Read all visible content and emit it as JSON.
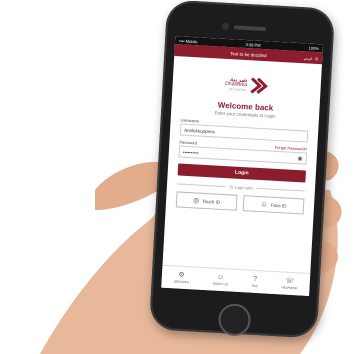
{
  "status": {
    "carrier": "•••• Mobile",
    "time": "3:38 PM",
    "battery": "100%"
  },
  "topbar": {
    "title": "Text to be decided",
    "lang": "عربي"
  },
  "logo": {
    "arabic": "ضريبة",
    "english": "Dhareeba",
    "tagline": "TAX PORTAL"
  },
  "welcome": {
    "title": "Welcome back",
    "subtitle": "Enter your credentials to Login"
  },
  "form": {
    "username_label": "Username",
    "username_value": "Annlekkuppens",
    "password_label": "Password",
    "forgot_label": "Forgot Password?",
    "password_value": "••••••••••"
  },
  "login_label": "Login",
  "or_label": "Or Login with",
  "biometrics": {
    "touch_label": "Touch ID",
    "face_label": "Face ID"
  },
  "tabs": [
    {
      "label": "SERVICES",
      "icon": "gear-icon"
    },
    {
      "label": "ABOUT US",
      "icon": "info-icon"
    },
    {
      "label": "FAQ",
      "icon": "faq-icon"
    },
    {
      "label": "HELPDESK",
      "icon": "headset-icon"
    }
  ],
  "colors": {
    "brand": "#8c1d2e",
    "phone_body": "#1c1c1e",
    "skin": "#e8b89a"
  }
}
